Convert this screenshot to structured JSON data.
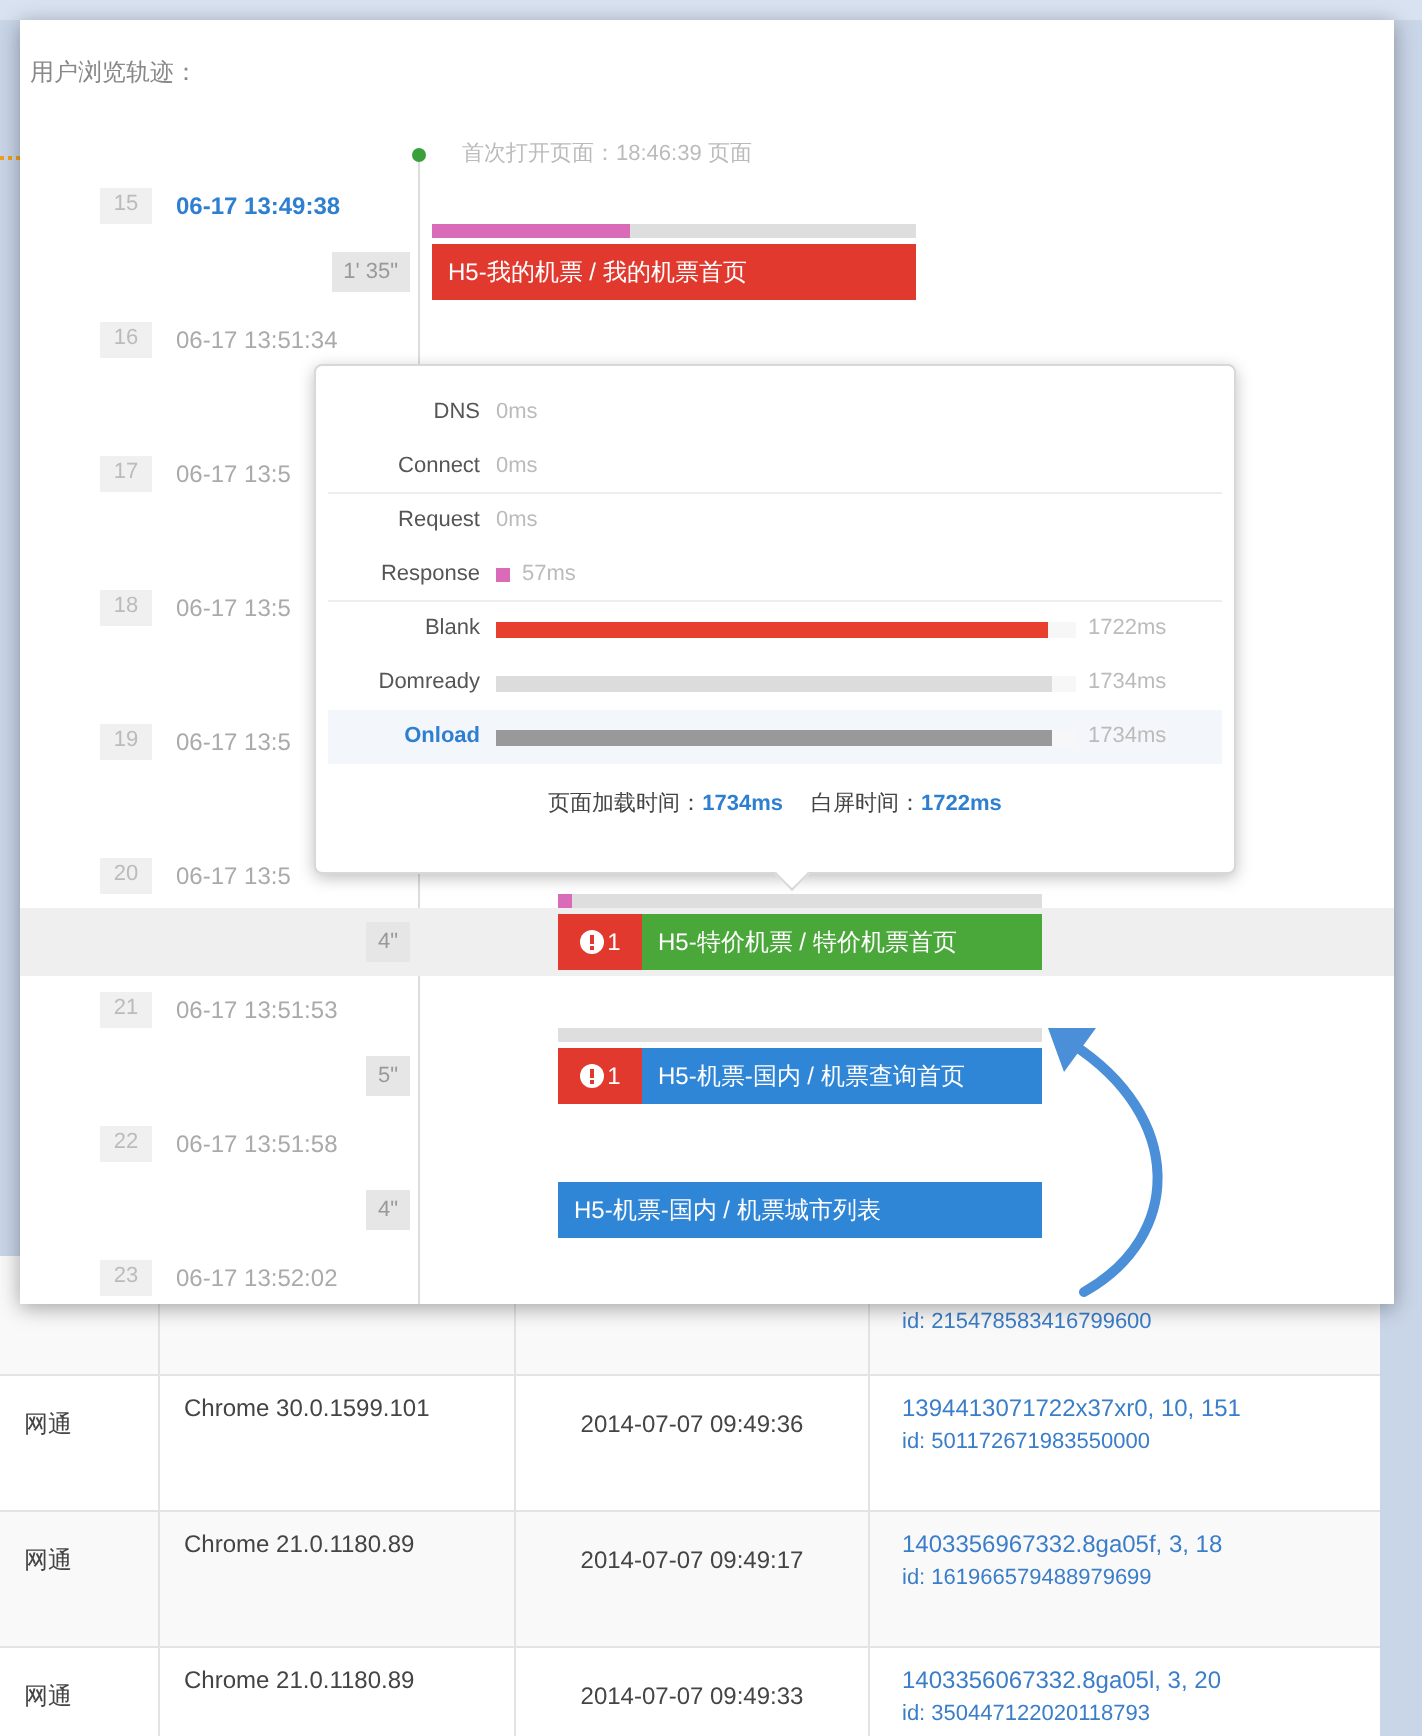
{
  "table": {
    "rows": [
      {
        "cells": [
          "",
          "",
          "",
          ""
        ],
        "id_line": "id: 215478583416799600"
      },
      {
        "cells": [
          "网通",
          "Chrome 30.0.1599.101",
          "2014-07-07 09:49:36",
          "1394413071722x37xr0, 10, 151"
        ],
        "id_line": "id: 501172671983550000"
      },
      {
        "cells": [
          "网通",
          "Chrome 21.0.1180.89",
          "2014-07-07 09:49:17",
          "1403356967332.8ga05f, 3, 18"
        ],
        "id_line": "id: 161966579488979699"
      },
      {
        "cells": [
          "网通",
          "Chrome 21.0.1180.89",
          "2014-07-07 09:49:33",
          "1403356067332.8ga05l, 3, 20"
        ],
        "id_line": "id: 350447122020118793"
      }
    ]
  },
  "panel": {
    "title": "用户浏览轨迹：",
    "first_open": "首次打开页面：18:46:39 页面",
    "visits": [
      {
        "index": "15",
        "time": "06-17 13:49:38",
        "selected": true,
        "step": {
          "duration": "1' 35\"",
          "page": "H5-我的机票 / 我的机票首页",
          "color": "#e2392f",
          "timing": {
            "level": 0.41
          },
          "highlighted": false
        }
      },
      {
        "index": "16",
        "time": "06-17 13:51:34",
        "selected": false
      },
      {
        "index": "17",
        "time": "06-17 13:5",
        "selected": false
      },
      {
        "index": "18",
        "time": "06-17 13:5",
        "selected": false
      },
      {
        "index": "19",
        "time": "06-17 13:5",
        "selected": false
      },
      {
        "index": "20",
        "time": "06-17 13:5",
        "selected": false,
        "step": {
          "duration": "4\"",
          "page": "H5-特价机票 / 特价机票首页",
          "color": "#4aa83a",
          "errors": "1",
          "timing": {
            "level": 0.03
          },
          "highlighted": true
        }
      },
      {
        "index": "21",
        "time": "06-17 13:51:53",
        "selected": false,
        "step": {
          "duration": "5\"",
          "page": "H5-机票-国内 / 机票查询首页",
          "color": "#2f86d6",
          "errors": "1",
          "timing": {
            "level": 0
          },
          "highlighted": false
        }
      },
      {
        "index": "22",
        "time": "06-17 13:51:58",
        "selected": false,
        "step": {
          "duration": "4\"",
          "page": "H5-机票-国内 / 机票城市列表",
          "color": "#2f86d6",
          "highlighted": false
        }
      },
      {
        "index": "23",
        "time": "06-17 13:52:02",
        "selected": false
      }
    ]
  },
  "tooltip": {
    "rows": [
      {
        "kind": "text",
        "label": "DNS",
        "value": "0ms",
        "highlighted": false,
        "divider": false
      },
      {
        "kind": "text",
        "label": "Connect",
        "value": "0ms",
        "highlighted": false,
        "divider": true
      },
      {
        "kind": "text",
        "label": "Request",
        "value": "0ms",
        "highlighted": false,
        "divider": false
      },
      {
        "kind": "marker",
        "label": "Response",
        "value": "57ms",
        "color": "#d96bb8",
        "highlighted": false,
        "divider": true
      },
      {
        "kind": "bar",
        "label": "Blank",
        "value": "1722ms",
        "level": 0.95,
        "color": "#e8402f",
        "highlighted": false,
        "divider": false
      },
      {
        "kind": "bar",
        "label": "Domready",
        "value": "1734ms",
        "level": 0.96,
        "color": "#dcdcdc",
        "highlighted": false,
        "divider": false
      },
      {
        "kind": "bar",
        "label": "Onload",
        "value": "1734ms",
        "level": 0.96,
        "color": "#999999",
        "highlighted": true,
        "divider": false
      }
    ],
    "summary": [
      {
        "label": "页面加载时间：",
        "value": "1734ms"
      },
      {
        "label": "白屏时间：",
        "value": "1722ms"
      }
    ]
  }
}
